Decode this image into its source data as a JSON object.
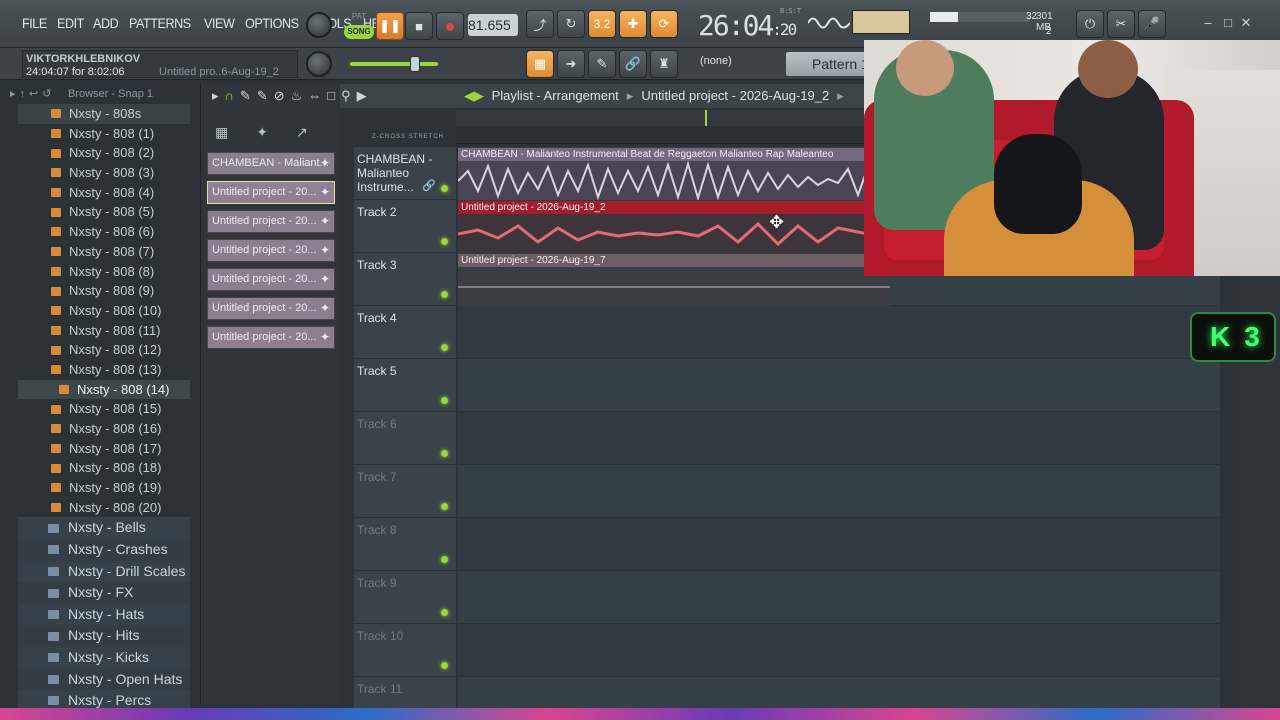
{
  "menu": [
    "FILE",
    "EDIT",
    "ADD",
    "PATTERNS",
    "VIEW",
    "OPTIONS",
    "TOOLS",
    "HELP"
  ],
  "transport": {
    "mode_pat": "PAT",
    "mode_song": "SONG",
    "tempo": "81.655",
    "time_main": "26:04",
    "time_sub": ":20",
    "time_unit": "B:S:T",
    "step_label": "3.2"
  },
  "cpu": {
    "voices": "32",
    "memory": "301 MB",
    "poly": "2"
  },
  "user": {
    "name": "VIKTORKHLEBNIKOV",
    "time_played": "24:04:07 for 8:02:06",
    "project": "Untitled pro..6-Aug-19_2"
  },
  "pattern": {
    "snap": "(none)",
    "name": "Pattern 1"
  },
  "browser": {
    "title": "Browser - Snap 1",
    "items": [
      "Nxsty - 808s",
      "Nxsty - 808 (1)",
      "Nxsty - 808 (2)",
      "Nxsty - 808 (3)",
      "Nxsty - 808 (4)",
      "Nxsty - 808 (5)",
      "Nxsty - 808 (6)",
      "Nxsty - 808 (7)",
      "Nxsty - 808 (8)",
      "Nxsty - 808 (9)",
      "Nxsty - 808 (10)",
      "Nxsty - 808 (11)",
      "Nxsty - 808 (12)",
      "Nxsty - 808 (13)",
      "Nxsty - 808 (14)",
      "Nxsty - 808 (15)",
      "Nxsty - 808 (16)",
      "Nxsty - 808 (17)",
      "Nxsty - 808 (18)",
      "Nxsty - 808 (19)",
      "Nxsty - 808 (20)"
    ],
    "folders": [
      "Nxsty - Bells",
      "Nxsty - Crashes",
      "Nxsty - Drill Scales",
      "Nxsty - FX",
      "Nxsty - Hats",
      "Nxsty - Hits",
      "Nxsty - Kicks",
      "Nxsty - Open Hats",
      "Nxsty - Percs"
    ]
  },
  "clip_picker": [
    "CHAMBEAN - Maliant...",
    "Untitled project - 20...",
    "Untitled project - 20...",
    "Untitled project - 20...",
    "Untitled project - 20...",
    "Untitled project - 20...",
    "Untitled project - 20..."
  ],
  "playlist": {
    "title": "Playlist - Arrangement",
    "project": "Untitled project - 2026-Aug-19_2",
    "xfade": "Z-CROSS  STRETCH",
    "tracks": [
      "CHAMBEAN - Malianteo Instrume...",
      "Track 2",
      "Track 3",
      "Track 4",
      "Track 5",
      "Track 6",
      "Track 7",
      "Track 8",
      "Track 9",
      "Track 10",
      "Track 11"
    ],
    "clips": [
      "CHAMBEAN - Malianteo Instrumental  Beat de Reggaeton Malianteo  Rap Maleanteo",
      "Untitled project - 2026-Aug-19_2",
      "Untitled project - 2026-Aug-19_7"
    ]
  },
  "overlay": {
    "key_letter": "K",
    "key_count": "3"
  },
  "colors": {
    "accent_green": "#9dd63a",
    "accent_orange": "#e08a30",
    "clip_red": "#a21e2a",
    "clip_purple": "#75697f"
  }
}
